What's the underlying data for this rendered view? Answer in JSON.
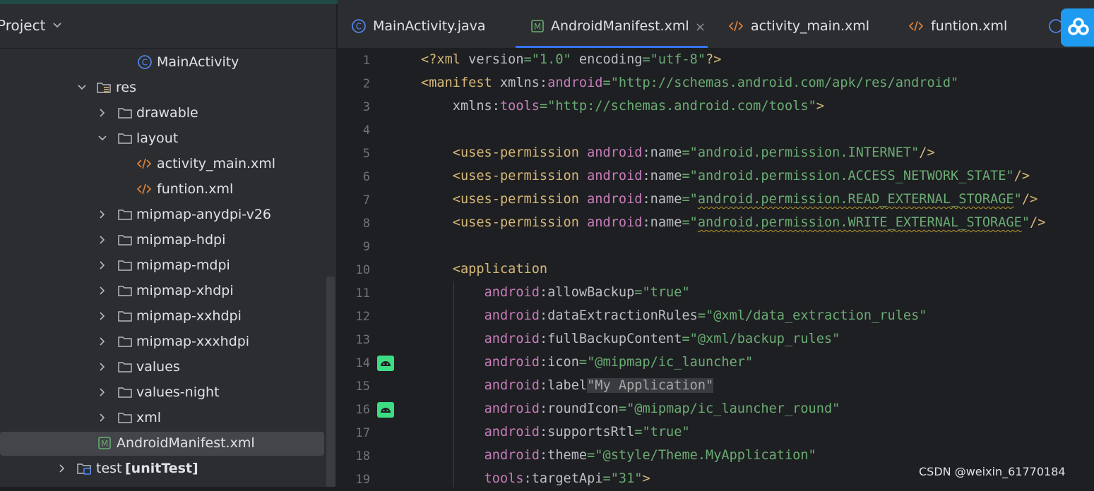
{
  "project": {
    "title": "Project"
  },
  "tree": [
    {
      "label": "MainActivity",
      "type": "class"
    },
    {
      "label": "res",
      "type": "resdir"
    },
    {
      "label": "drawable",
      "type": "folder"
    },
    {
      "label": "layout",
      "type": "folder"
    },
    {
      "label": "activity_main.xml",
      "type": "xml"
    },
    {
      "label": "funtion.xml",
      "type": "xml"
    },
    {
      "label": "mipmap-anydpi-v26",
      "type": "folder"
    },
    {
      "label": "mipmap-hdpi",
      "type": "folder"
    },
    {
      "label": "mipmap-mdpi",
      "type": "folder"
    },
    {
      "label": "mipmap-xhdpi",
      "type": "folder"
    },
    {
      "label": "mipmap-xxhdpi",
      "type": "folder"
    },
    {
      "label": "mipmap-xxxhdpi",
      "type": "folder"
    },
    {
      "label": "values",
      "type": "folder"
    },
    {
      "label": "values-night",
      "type": "folder"
    },
    {
      "label": "xml",
      "type": "folder"
    },
    {
      "label": "AndroidManifest.xml",
      "type": "manifest"
    },
    {
      "label": "test",
      "suffix": "[unitTest]",
      "type": "testdir"
    }
  ],
  "tabs": [
    {
      "label": "MainActivity.java"
    },
    {
      "label": "AndroidManifest.xml",
      "close": "×"
    },
    {
      "label": "activity_main.xml"
    },
    {
      "label": "funtion.xml"
    }
  ],
  "editor": {
    "line_numbers": [
      "1",
      "2",
      "3",
      "4",
      "5",
      "6",
      "7",
      "8",
      "9",
      "10",
      "11",
      "12",
      "13",
      "14",
      "15",
      "16",
      "17",
      "18",
      "19"
    ]
  },
  "colors": {
    "tag": "#d5b778",
    "namespace": "#c77dbb",
    "string": "#6aab73",
    "accent": "#3574f0",
    "android_green": "#3ddc84"
  },
  "watermark": "CSDN @weixin_61770184"
}
